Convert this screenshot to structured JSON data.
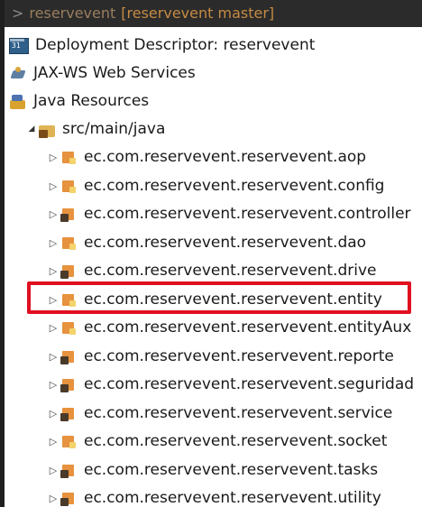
{
  "header": {
    "arrow": ">",
    "project": "reservevent",
    "branch": "[reservevent master]"
  },
  "tree": {
    "deployment_descriptor": "Deployment Descriptor: reservevent",
    "jaxws": "JAX-WS Web Services",
    "java_resources": "Java Resources",
    "src_folder": "src/main/java",
    "packages": [
      {
        "label": "ec.com.reservevent.reservevent.aop",
        "icon": "package-icon"
      },
      {
        "label": "ec.com.reservevent.reservevent.config",
        "icon": "package-icon"
      },
      {
        "label": "ec.com.reservevent.reservevent.controller",
        "icon": "package-dark-icon"
      },
      {
        "label": "ec.com.reservevent.reservevent.dao",
        "icon": "package-icon"
      },
      {
        "label": "ec.com.reservevent.reservevent.drive",
        "icon": "package-dark-icon"
      },
      {
        "label": "ec.com.reservevent.reservevent.entity",
        "icon": "package-icon"
      },
      {
        "label": "ec.com.reservevent.reservevent.entityAux",
        "icon": "package-icon"
      },
      {
        "label": "ec.com.reservevent.reservevent.reporte",
        "icon": "package-dark-icon"
      },
      {
        "label": "ec.com.reservevent.reservevent.seguridad",
        "icon": "package-dark-icon"
      },
      {
        "label": "ec.com.reservevent.reservevent.service",
        "icon": "package-dark-icon"
      },
      {
        "label": "ec.com.reservevent.reservevent.socket",
        "icon": "package-icon"
      },
      {
        "label": "ec.com.reservevent.reservevent.tasks",
        "icon": "package-dark-icon"
      },
      {
        "label": "ec.com.reservevent.reservevent.utility",
        "icon": "package-dark-icon"
      }
    ]
  },
  "colors": {
    "highlight": "#e01020",
    "header_bg": "#2b2b2b",
    "header_text": "#9a7e5e"
  }
}
